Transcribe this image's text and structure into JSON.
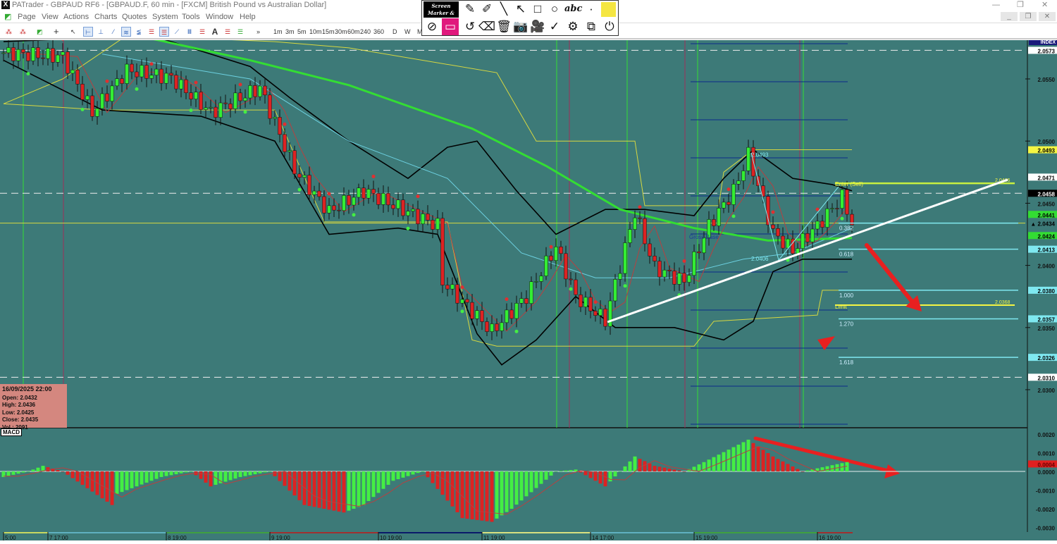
{
  "window": {
    "title": "PATrader - GBPAUD RF6 - [GBPAUD.F, 60 min - [FXCM] British Pound vs Australian Dollar]",
    "logo": "X",
    "minimize": "—",
    "restore": "❐",
    "close": "✕"
  },
  "menu": [
    "Page",
    "View",
    "Actions",
    "Charts",
    "Quotes",
    "System",
    "Tools",
    "Window",
    "Help"
  ],
  "mdi_controls": [
    "_",
    "❐",
    "✕"
  ],
  "toolbar": {
    "timeframes": [
      "1m",
      "3m",
      "5m",
      "10m",
      "15m",
      "30m",
      "60m",
      "240",
      "360",
      "D",
      "W",
      "M"
    ],
    "more": "»"
  },
  "screen_marker": {
    "brand": "Screen Marker & Recorder",
    "text_tool": "abc",
    "dot": "·",
    "color": "#f5e642"
  },
  "info_box": {
    "datetime": "16/09/2025 22:00",
    "open": "Open: 2.0432",
    "high": "High: 2.0436",
    "low": "Low: 2.0425",
    "close": "Close: 2.0435",
    "volume": "Vol.: 2091"
  },
  "macd_label": "MACD",
  "axis_header": "INDEX",
  "price_labels": [
    {
      "v": 2.0573,
      "text": "2.0573",
      "bg": "#ffffff",
      "fg": "#000"
    },
    {
      "v": 2.0493,
      "text": "2.0493",
      "bg": "#f5f542",
      "fg": "#000"
    },
    {
      "v": 2.0471,
      "text": "2.0471",
      "bg": "#ffffff",
      "fg": "#000"
    },
    {
      "v": 2.0458,
      "text": "2.0458",
      "bg": "#000000",
      "fg": "#fff"
    },
    {
      "v": 2.0441,
      "text": "2.0441",
      "bg": "#33dd33",
      "fg": "#000"
    },
    {
      "v": 2.0434,
      "text": "▲ 2.0434",
      "bg": "#3d7a78",
      "fg": "#000"
    },
    {
      "v": 2.0424,
      "text": "2.0424",
      "bg": "#33dd33",
      "fg": "#000"
    },
    {
      "v": 2.0413,
      "text": "2.0413",
      "bg": "#7fe8f0",
      "fg": "#000"
    },
    {
      "v": 2.038,
      "text": "2.0380",
      "bg": "#7fe8f0",
      "fg": "#000"
    },
    {
      "v": 2.0357,
      "text": "2.0357",
      "bg": "#7fe8f0",
      "fg": "#000"
    },
    {
      "v": 2.0326,
      "text": "2.0326",
      "bg": "#7fe8f0",
      "fg": "#000"
    },
    {
      "v": 2.031,
      "text": "2.0310",
      "bg": "#ffffff",
      "fg": "#000"
    }
  ],
  "macd_value_label": {
    "v": 0.0004,
    "text": "0.0004",
    "bg": "#e02020"
  },
  "chart_data": {
    "type": "candlestick",
    "symbol": "GBPAUD.F",
    "interval": "60 min",
    "price_ticks": [
      "2.0550",
      "2.0500",
      "2.0450",
      "2.0400",
      "2.0350",
      "2.0300"
    ],
    "price_tick_values": [
      2.055,
      2.05,
      2.045,
      2.04,
      2.035,
      2.03
    ],
    "macd_ticks": [
      "0.0020",
      "0.0010",
      "0.0000",
      "-0.0010",
      "-0.0020",
      "-0.0030"
    ],
    "macd_tick_values": [
      0.002,
      0.001,
      0,
      -0.001,
      -0.002,
      -0.003
    ],
    "time_labels": [
      {
        "i": 0,
        "t": "5:00"
      },
      {
        "i": 9,
        "t": "7 17:00"
      },
      {
        "i": 33,
        "t": "8 19:00"
      },
      {
        "i": 54,
        "t": "9 19:00"
      },
      {
        "i": 76,
        "t": "10 19:00"
      },
      {
        "i": 97,
        "t": "11 19:00"
      },
      {
        "i": 119,
        "t": "14 17:00"
      },
      {
        "i": 140,
        "t": "15 19:00"
      },
      {
        "i": 165,
        "t": "16 19:00"
      }
    ],
    "price_path": [
      [
        0,
        2.0571
      ],
      [
        12,
        2.0568
      ],
      [
        18,
        2.0523
      ],
      [
        25,
        2.0557
      ],
      [
        34,
        2.0551
      ],
      [
        42,
        2.0523
      ],
      [
        52,
        2.0543
      ],
      [
        59,
        2.0477
      ],
      [
        66,
        2.0443
      ],
      [
        73,
        2.046
      ],
      [
        82,
        2.0443
      ],
      [
        88,
        2.0432
      ],
      [
        89,
        2.0387
      ],
      [
        99,
        2.0347
      ],
      [
        106,
        2.0375
      ],
      [
        112,
        2.0415
      ],
      [
        116,
        2.0375
      ],
      [
        122,
        2.0356
      ],
      [
        128,
        2.0443
      ],
      [
        132,
        2.0398
      ],
      [
        138,
        2.0387
      ],
      [
        143,
        2.0432
      ],
      [
        148,
        2.046
      ],
      [
        151,
        2.0489
      ],
      [
        156,
        2.0426
      ],
      [
        160,
        2.0412
      ],
      [
        165,
        2.0432
      ],
      [
        170,
        2.0455
      ],
      [
        172,
        2.0434
      ]
    ],
    "bollinger_upper": [
      [
        0,
        2.058
      ],
      [
        30,
        2.0585
      ],
      [
        50,
        2.056
      ],
      [
        58,
        2.0535
      ],
      [
        70,
        2.05
      ],
      [
        82,
        2.047
      ],
      [
        90,
        2.0495
      ],
      [
        96,
        2.05
      ],
      [
        104,
        2.046
      ],
      [
        112,
        2.0425
      ],
      [
        122,
        2.0445
      ],
      [
        130,
        2.0445
      ],
      [
        140,
        2.044
      ],
      [
        146,
        2.047
      ],
      [
        152,
        2.0493
      ],
      [
        160,
        2.047
      ],
      [
        168,
        2.0465
      ],
      [
        172,
        2.046
      ]
    ],
    "bollinger_lower": [
      [
        0,
        2.0565
      ],
      [
        20,
        2.0525
      ],
      [
        40,
        2.052
      ],
      [
        55,
        2.05
      ],
      [
        66,
        2.0425
      ],
      [
        80,
        2.043
      ],
      [
        88,
        2.0425
      ],
      [
        96,
        2.0345
      ],
      [
        101,
        2.032
      ],
      [
        108,
        2.034
      ],
      [
        116,
        2.0375
      ],
      [
        124,
        2.035
      ],
      [
        136,
        2.035
      ],
      [
        146,
        2.034
      ],
      [
        152,
        2.0355
      ],
      [
        156,
        2.0395
      ],
      [
        162,
        2.0405
      ],
      [
        172,
        2.0405
      ]
    ],
    "ma_long": [
      [
        27,
        2.0585
      ],
      [
        50,
        2.0565
      ],
      [
        70,
        2.0545
      ],
      [
        95,
        2.051
      ],
      [
        110,
        2.048
      ],
      [
        125,
        2.0445
      ],
      [
        140,
        2.043
      ],
      [
        155,
        2.042
      ],
      [
        172,
        2.0422
      ]
    ],
    "ma_mid": [
      [
        20,
        2.057
      ],
      [
        50,
        2.055
      ],
      [
        70,
        2.05
      ],
      [
        90,
        2.047
      ],
      [
        105,
        2.041
      ],
      [
        120,
        2.039
      ],
      [
        135,
        2.039
      ],
      [
        150,
        2.0405
      ],
      [
        160,
        2.041
      ],
      [
        172,
        2.043
      ]
    ],
    "donchian": [
      [
        0,
        2.053
      ],
      [
        12,
        2.055
      ],
      [
        25,
        2.0585
      ],
      [
        55,
        2.058
      ],
      [
        70,
        2.0575
      ],
      [
        100,
        2.0555
      ],
      [
        108,
        2.05
      ],
      [
        128,
        2.05
      ],
      [
        130,
        2.0448
      ],
      [
        145,
        2.0448
      ],
      [
        146,
        2.0475
      ],
      [
        152,
        2.0493
      ],
      [
        172,
        2.0493
      ]
    ],
    "donchian_low": [
      [
        0,
        2.053
      ],
      [
        20,
        2.0525
      ],
      [
        55,
        2.0525
      ],
      [
        65,
        2.0435
      ],
      [
        90,
        2.0435
      ],
      [
        95,
        2.034
      ],
      [
        100,
        2.0335
      ],
      [
        140,
        2.0335
      ],
      [
        144,
        2.0355
      ],
      [
        165,
        2.036
      ],
      [
        166,
        2.038
      ],
      [
        172,
        2.038
      ]
    ],
    "macd_hist": [
      [
        0,
        -0.0003
      ],
      [
        5,
        0
      ],
      [
        8,
        0.0003
      ],
      [
        12,
        0
      ],
      [
        22,
        -0.0018
      ],
      [
        23,
        -0.0012
      ],
      [
        32,
        -0.0003
      ],
      [
        38,
        0
      ],
      [
        42,
        -0.0008
      ],
      [
        48,
        -0.0003
      ],
      [
        54,
        0
      ],
      [
        61,
        -0.0018
      ],
      [
        69,
        -0.0022
      ],
      [
        73,
        -0.0018
      ],
      [
        79,
        -0.0005
      ],
      [
        85,
        0
      ],
      [
        93,
        -0.0025
      ],
      [
        99,
        -0.0027
      ],
      [
        103,
        -0.002
      ],
      [
        112,
        0
      ],
      [
        116,
        0.0001
      ],
      [
        122,
        -0.0008
      ],
      [
        125,
        0
      ],
      [
        128,
        0.0008
      ],
      [
        132,
        0.0003
      ],
      [
        138,
        0
      ],
      [
        142,
        0.0005
      ],
      [
        151,
        0.0017
      ],
      [
        156,
        0.0008
      ],
      [
        162,
        0
      ],
      [
        171,
        0.0005
      ]
    ],
    "fib_levels": [
      {
        "label": "0.382",
        "v": 2.0434
      },
      {
        "label": "0.618",
        "v": 2.0413
      },
      {
        "label": "1.000",
        "v": 2.038
      },
      {
        "label": "1.270",
        "v": 2.0357
      },
      {
        "label": "1.618",
        "v": 2.0326
      }
    ],
    "annotations": {
      "high": "2.0493",
      "low": "2.0406",
      "entry": "Enter (Sell)",
      "entry_price": "2.0466",
      "limit": "Limit",
      "limit_price": "2.0368",
      "stop": "Gross Base"
    }
  }
}
